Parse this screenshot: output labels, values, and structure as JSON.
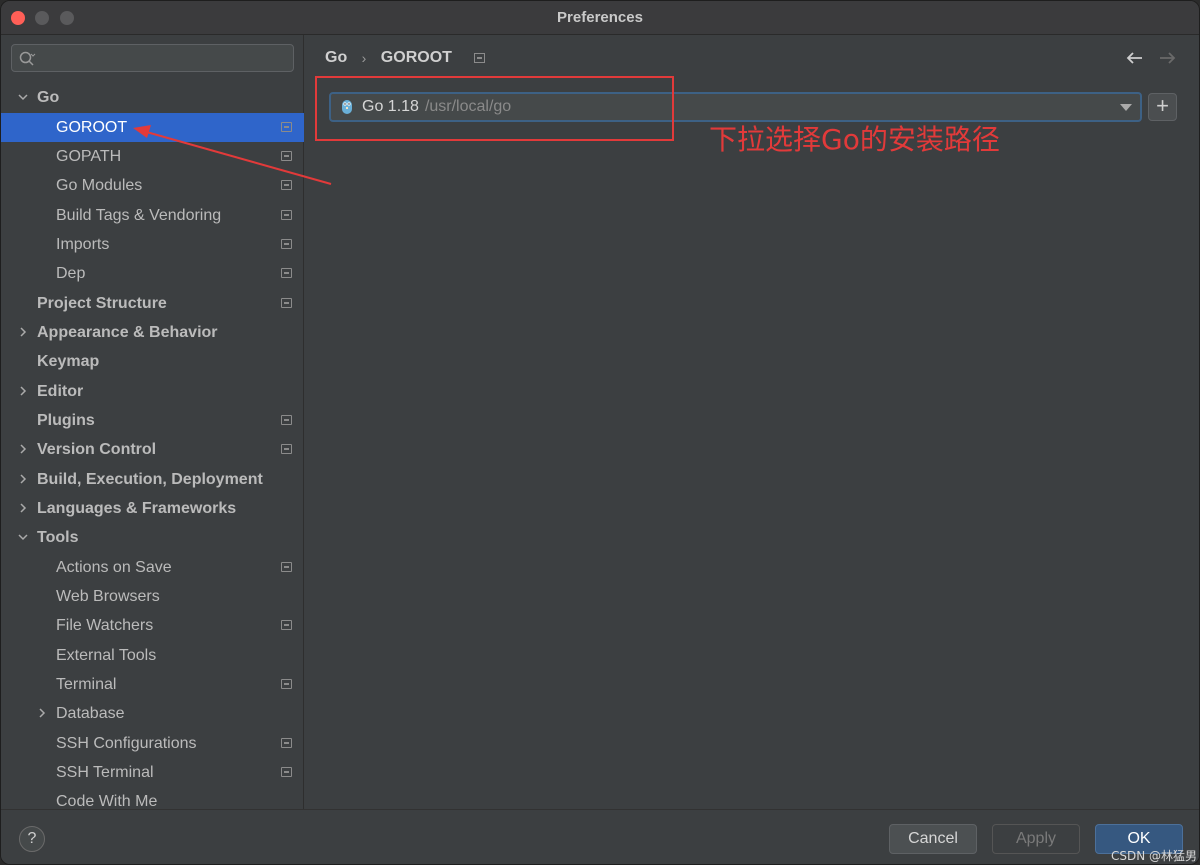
{
  "window": {
    "title": "Preferences"
  },
  "search": {
    "placeholder": ""
  },
  "sidebar": {
    "items": [
      {
        "label": "Go",
        "expanded": true,
        "bold": true
      },
      {
        "label": "GOROOT",
        "selected": true
      },
      {
        "label": "GOPATH"
      },
      {
        "label": "Go Modules"
      },
      {
        "label": "Build Tags & Vendoring"
      },
      {
        "label": "Imports"
      },
      {
        "label": "Dep"
      },
      {
        "label": "Project Structure",
        "bold": true
      },
      {
        "label": "Appearance & Behavior",
        "bold": true,
        "collapsed": true
      },
      {
        "label": "Keymap",
        "bold": true
      },
      {
        "label": "Editor",
        "bold": true,
        "collapsed": true
      },
      {
        "label": "Plugins",
        "bold": true
      },
      {
        "label": "Version Control",
        "bold": true,
        "collapsed": true
      },
      {
        "label": "Build, Execution, Deployment",
        "bold": true,
        "collapsed": true
      },
      {
        "label": "Languages & Frameworks",
        "bold": true,
        "collapsed": true
      },
      {
        "label": "Tools",
        "bold": true,
        "expanded": true
      },
      {
        "label": "Actions on Save"
      },
      {
        "label": "Web Browsers"
      },
      {
        "label": "File Watchers"
      },
      {
        "label": "External Tools"
      },
      {
        "label": "Terminal"
      },
      {
        "label": "Database",
        "collapsed": true
      },
      {
        "label": "SSH Configurations"
      },
      {
        "label": "SSH Terminal"
      },
      {
        "label": "Code With Me"
      }
    ]
  },
  "breadcrumb": {
    "parent": "Go",
    "current": "GOROOT"
  },
  "sdk": {
    "version": "Go 1.18",
    "path": "/usr/local/go"
  },
  "annotation": {
    "text": "下拉选择Go的安装路径",
    "color": "#e23a3a"
  },
  "footer": {
    "cancel": "Cancel",
    "apply": "Apply",
    "ok": "OK",
    "help": "?"
  },
  "watermark": "CSDN @林猛男",
  "colors": {
    "selection": "#2f65ca",
    "accent": "#365880",
    "annotation": "#e23a3a"
  }
}
